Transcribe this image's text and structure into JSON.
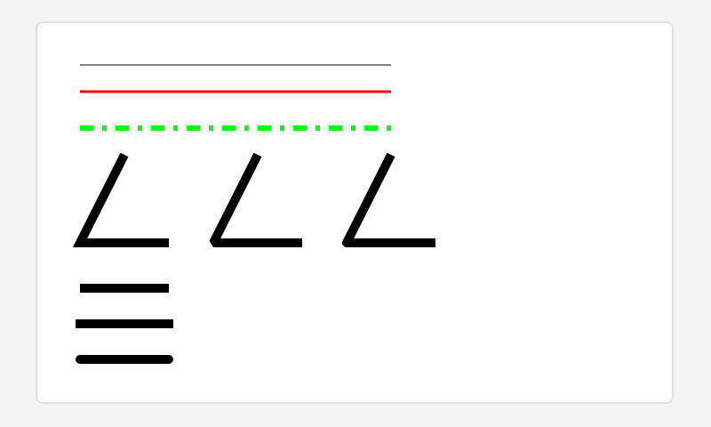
{
  "canvas": {
    "background": "#f4f4f4",
    "card_background": "#ffffff",
    "card_border": "#e0e0e0"
  },
  "strokes": {
    "thin_line_color": "#808080",
    "red_line_color": "#ff0000",
    "dash_dot_line_color": "#00ff00",
    "line_join_samples_color": "#000000",
    "line_cap_samples_color": "#000000"
  },
  "line_join_samples": [
    "miter",
    "bevel",
    "round"
  ],
  "line_cap_samples": [
    "butt",
    "square",
    "round"
  ]
}
